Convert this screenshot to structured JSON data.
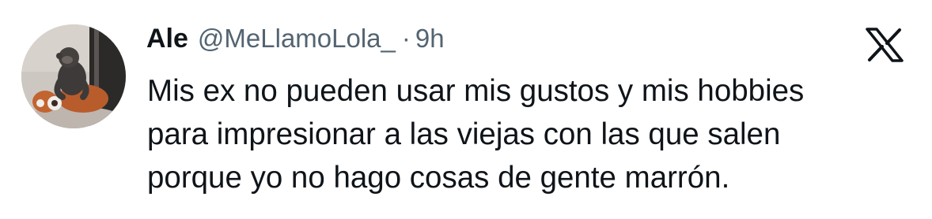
{
  "tweet": {
    "author": {
      "display_name": "Ale",
      "handle": "@MeLlamoLola_",
      "avatar_icon": "avatar-photo"
    },
    "separator": "·",
    "timestamp": "9h",
    "platform_icon": "x-logo-icon",
    "text_lines": [
      "Mis ex no pueden usar mis gustos y mis hobbies",
      "para impresionar a las viejas con las que salen",
      "porque yo no hago cosas de gente marrón."
    ]
  },
  "colors": {
    "text_primary": "#0f1419",
    "text_secondary": "#536471",
    "background": "#ffffff"
  }
}
